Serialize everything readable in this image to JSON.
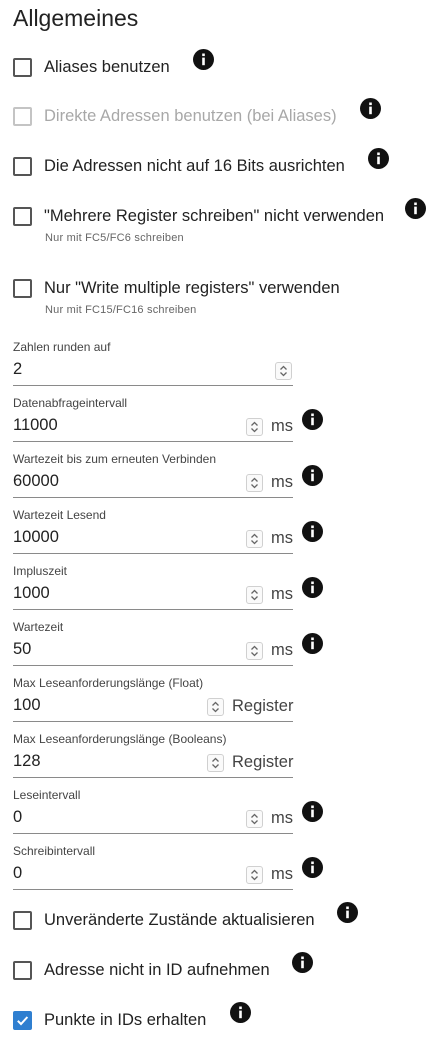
{
  "section_title": "Allgemeines",
  "checkboxes_top": [
    {
      "label": "Aliases benutzen",
      "checked": false,
      "disabled": false
    },
    {
      "label": "Direkte Adressen benutzen (bei Aliases)",
      "checked": false,
      "disabled": true
    },
    {
      "label": "Die Adressen nicht auf 16 Bits ausrichten",
      "checked": false,
      "disabled": false
    },
    {
      "label": "\"Mehrere Register schreiben\" nicht verwenden",
      "help": "Nur mit FC5/FC6 schreiben",
      "checked": false,
      "disabled": false
    },
    {
      "label": "Nur \"Write multiple registers\" verwenden",
      "help": "Nur mit FC15/FC16 schreiben",
      "checked": false,
      "disabled": false
    }
  ],
  "fields": [
    {
      "label": "Zahlen runden auf",
      "value": "2",
      "unit": ""
    },
    {
      "label": "Datenabfrageintervall",
      "value": "11000",
      "unit": "ms"
    },
    {
      "label": "Wartezeit bis zum erneuten Verbinden",
      "value": "60000",
      "unit": "ms"
    },
    {
      "label": "Wartezeit Lesend",
      "value": "10000",
      "unit": "ms"
    },
    {
      "label": "Impluszeit",
      "value": "1000",
      "unit": "ms"
    },
    {
      "label": "Wartezeit",
      "value": "50",
      "unit": "ms"
    },
    {
      "label": "Max Leseanforderungslänge (Float)",
      "value": "100",
      "unit": "Register"
    },
    {
      "label": "Max Leseanforderungslänge (Booleans)",
      "value": "128",
      "unit": "Register"
    },
    {
      "label": "Leseintervall",
      "value": "0",
      "unit": "ms"
    },
    {
      "label": "Schreibintervall",
      "value": "0",
      "unit": "ms"
    }
  ],
  "checkboxes_bottom": [
    {
      "label": "Unveränderte Zustände aktualisieren",
      "checked": false,
      "disabled": false
    },
    {
      "label": "Adresse nicht in ID aufnehmen",
      "checked": false,
      "disabled": false
    },
    {
      "label": "Punkte in IDs erhalten",
      "checked": true,
      "disabled": false
    }
  ],
  "colors": {
    "accent": "#2f7fd0",
    "info_icon": "#111111",
    "disabled_text": "#a8a8a8"
  },
  "icons": {
    "info": "info-icon",
    "stepper": "stepper-up-down-icon",
    "check": "check-icon"
  }
}
